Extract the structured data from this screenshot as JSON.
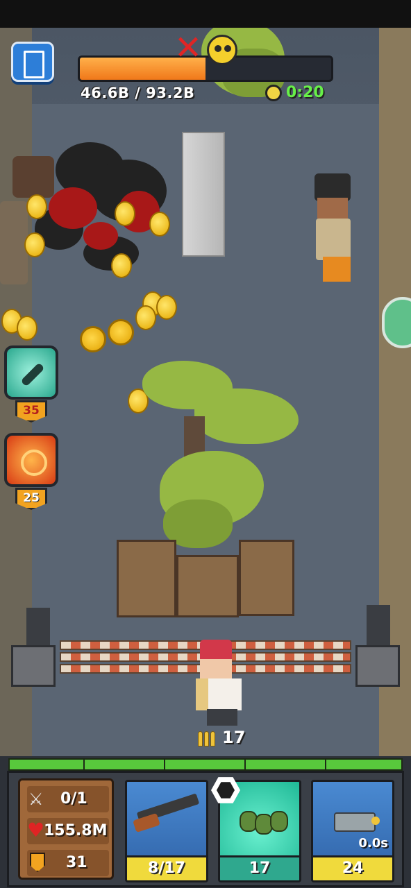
{
  "hud": {
    "boss_hp_text": "46.6B / 93.2B",
    "boss_hp_fraction": 0.5,
    "timer": "0:20"
  },
  "skills": [
    {
      "name": "repair-wrench-skill",
      "level": "35"
    },
    {
      "name": "target-burst-skill",
      "level": "25"
    }
  ],
  "ammo": {
    "count": "17"
  },
  "wave": {
    "segments": 5
  },
  "stats": {
    "kills": "0/1",
    "health": "155.8M",
    "shield": "31"
  },
  "weapons": [
    {
      "name": "shotgun",
      "label": "8/17"
    },
    {
      "name": "grenades",
      "label": "17"
    },
    {
      "name": "battery-cannon",
      "label": "24",
      "cooldown": "0.0s"
    }
  ],
  "colors": {
    "health_fill": "#f0781a",
    "timer_text": "#67f048",
    "wave_bar": "#58c93c",
    "weapon_label": "#f0da3c",
    "grenade_card": "#2fd3b0",
    "weapon_card": "#3a77c0"
  }
}
